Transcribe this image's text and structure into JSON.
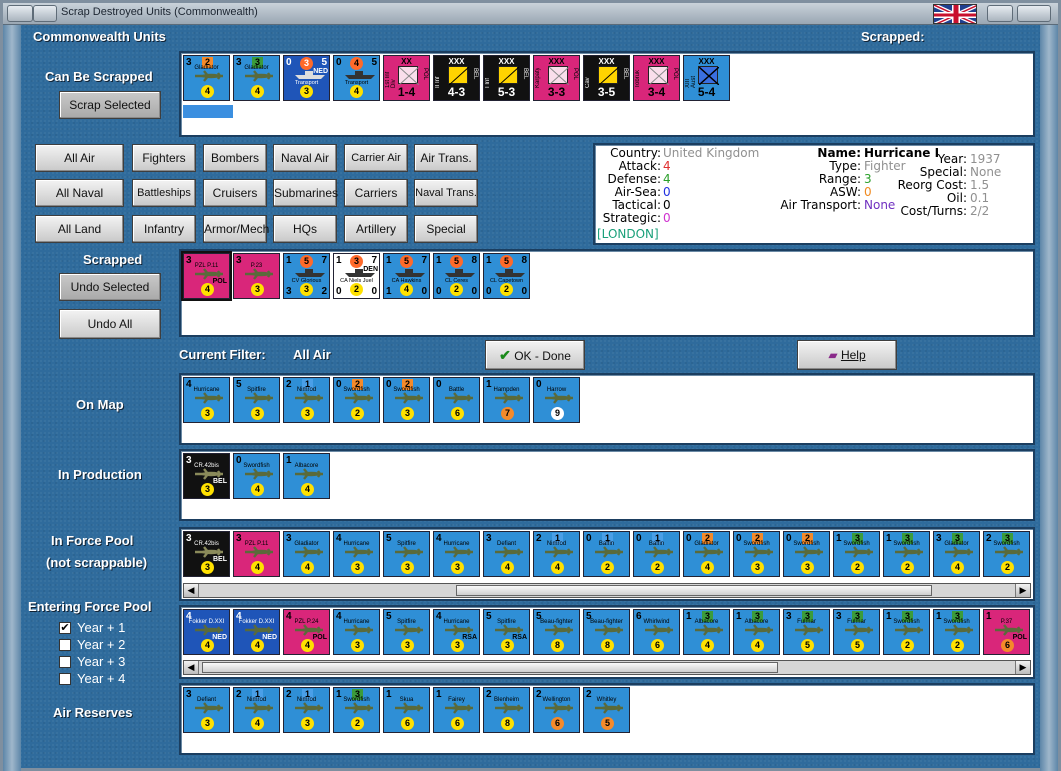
{
  "window": {
    "title": "Scrap Destroyed Units (Commonwealth)"
  },
  "header": {
    "units_label": "Commonwealth Units",
    "scrapped_label": "Scrapped:"
  },
  "can_be_scrapped": {
    "label": "Can Be Scrapped",
    "button": "Scrap Selected",
    "units": [
      {
        "name": "Gladiator",
        "lt": "3",
        "tb": "2",
        "tbc": "#f48a2a",
        "circ": "4",
        "bg": "#2f8fd6",
        "kind": "air"
      },
      {
        "name": "Gladiator",
        "lt": "3",
        "tb": "3",
        "tbc": "#3b9c3b",
        "circ": "4",
        "bg": "#2f8fd6",
        "kind": "air"
      },
      {
        "name": "Transport",
        "lt": "0",
        "tb": "3",
        "tbc": "#ff6a2a",
        "circ": "3",
        "bg": "#1f55b8",
        "kind": "naval",
        "rb": "5",
        "extra": "NED"
      },
      {
        "name": "Transport",
        "lt": "0",
        "tb": "4",
        "tbc": "#ff6a2a",
        "circ": "4",
        "bg": "#2f8fd6",
        "kind": "naval",
        "rb": "5"
      },
      {
        "name": "1st Inf Div",
        "top": "XX",
        "big": "1-4",
        "bg": "#d9267a",
        "kind": "land",
        "side": "POL"
      },
      {
        "name": "II Inf",
        "top": "XXX",
        "big": "4-3",
        "bg": "#111",
        "kind": "land",
        "side": "BEL"
      },
      {
        "name": "I Inf",
        "top": "XXX",
        "big": "5-3",
        "bg": "#111",
        "kind": "land",
        "side": "BEL"
      },
      {
        "name": "Karpaty",
        "top": "XXX",
        "big": "3-3",
        "bg": "#d9267a",
        "kind": "land",
        "side": "POL"
      },
      {
        "name": "Cav",
        "top": "XXX",
        "big": "3-5",
        "bg": "#111",
        "kind": "land",
        "side": "BEL"
      },
      {
        "name": "Tobruk",
        "top": "XXX",
        "big": "3-4",
        "bg": "#d9267a",
        "kind": "land",
        "side": "POL"
      },
      {
        "name": "XIII Aust",
        "top": "XXX",
        "big": "5-4",
        "bg": "#2f8fd6",
        "kind": "land"
      }
    ]
  },
  "filters": {
    "row1": [
      "All Air",
      "Fighters",
      "Bombers",
      "Naval Air",
      "Carrier Air",
      "Air Trans."
    ],
    "row2": [
      "All Naval",
      "Battleships",
      "Cruisers",
      "Submarines",
      "Carriers",
      "Naval Trans."
    ],
    "row3": [
      "All Land",
      "Infantry",
      "Armor/Mech",
      "HQs",
      "Artillery",
      "Special"
    ]
  },
  "info": {
    "country_k": "Country:",
    "country_v": "United Kingdom",
    "attack_k": "Attack:",
    "attack_v": "4",
    "defense_k": "Defense:",
    "defense_v": "4",
    "airsea_k": "Air-Sea:",
    "airsea_v": "0",
    "tactical_k": "Tactical:",
    "tactical_v": "0",
    "strategic_k": "Strategic:",
    "strategic_v": "0",
    "location": "[LONDON]",
    "name_k": "Name:",
    "name_v": "Hurricane I",
    "type_k": "Type:",
    "type_v": "Fighter",
    "range_k": "Range:",
    "range_v": "3",
    "asw_k": "ASW:",
    "asw_v": "0",
    "airtrans_k": "Air Transport:",
    "airtrans_v": "None",
    "year_k": "Year:",
    "year_v": "1937",
    "special_k": "Special:",
    "special_v": "None",
    "reorg_k": "Reorg Cost:",
    "reorg_v": "1.5",
    "oil_k": "Oil:",
    "oil_v": "0.1",
    "cost_k": "Cost/Turns:",
    "cost_v": "2/2",
    "colors": {
      "attack": "#e03030",
      "defense": "#2aa02a",
      "airsea": "#2030e0",
      "strategic": "#d030d0",
      "location": "#1aa07a",
      "type": "#909090",
      "range": "#2aa02a",
      "asw": "#f08a20",
      "airtrans": "#7030c0"
    }
  },
  "scrapped": {
    "label": "Scrapped",
    "undo_selected": "Undo Selected",
    "undo_all": "Undo All",
    "units": [
      {
        "name": "PZL P.11",
        "lt": "3",
        "circ": "4",
        "bg": "#d9267a",
        "kind": "air",
        "side": "POL",
        "sel": true
      },
      {
        "name": "P.23",
        "lt": "3",
        "circ": "3",
        "bg": "#d9267a",
        "kind": "air"
      },
      {
        "name": "CV Glorious",
        "lt": "1",
        "tb": "5",
        "tbc": "#ff6a2a",
        "circ": "3",
        "bg": "#2f8fd6",
        "kind": "naval",
        "rb": "7",
        "lb": "3",
        "rbb": "2"
      },
      {
        "name": "CA Niels Juel",
        "lt": "1",
        "tb": "3",
        "tbc": "#ff6a2a",
        "circ": "2",
        "bg": "#fff",
        "kind": "naval",
        "rb": "7",
        "lb": "0",
        "rbb": "0",
        "extra": "DEN"
      },
      {
        "name": "CA Hawkins",
        "lt": "1",
        "tb": "5",
        "tbc": "#ff6a2a",
        "circ": "4",
        "bg": "#2f8fd6",
        "kind": "naval",
        "rb": "7",
        "lb": "1",
        "rbb": "0"
      },
      {
        "name": "CL Ceres",
        "lt": "1",
        "tb": "5",
        "tbc": "#ff6a2a",
        "circ": "2",
        "bg": "#2f8fd6",
        "kind": "naval",
        "rb": "8",
        "lb": "0",
        "rbb": "0"
      },
      {
        "name": "CL Capetown",
        "lt": "1",
        "tb": "5",
        "tbc": "#ff6a2a",
        "circ": "2",
        "bg": "#2f8fd6",
        "kind": "naval",
        "rb": "8",
        "lb": "0",
        "rbb": "0"
      }
    ]
  },
  "filter_status": {
    "label": "Current Filter:",
    "value": "All Air"
  },
  "buttons": {
    "ok": "OK - Done",
    "help": "Help"
  },
  "on_map": {
    "label": "On Map",
    "units": [
      {
        "name": "Hurricane",
        "lt": "4",
        "circ": "3",
        "bg": "#2f8fd6",
        "kind": "air"
      },
      {
        "name": "Spitfire",
        "lt": "5",
        "circ": "3",
        "bg": "#2f8fd6",
        "kind": "air"
      },
      {
        "name": "Nimrod",
        "lt": "2",
        "tb": "1",
        "tbc": "#4a9fe8",
        "circ": "3",
        "bg": "#2f8fd6",
        "kind": "air"
      },
      {
        "name": "Swordfish",
        "lt": "0",
        "tb": "2",
        "tbc": "#f48a2a",
        "circ": "2",
        "bg": "#2f8fd6",
        "kind": "air"
      },
      {
        "name": "Swordfish",
        "lt": "0",
        "tb": "2",
        "tbc": "#f48a2a",
        "circ": "3",
        "bg": "#2f8fd6",
        "kind": "air"
      },
      {
        "name": "Battle",
        "lt": "0",
        "circ": "6",
        "bg": "#2f8fd6",
        "kind": "air"
      },
      {
        "name": "Hampden",
        "lt": "1",
        "circ": "7",
        "bg": "#2f8fd6",
        "kind": "air",
        "circc": "#f48a2a"
      },
      {
        "name": "Harrow",
        "lt": "0",
        "circ": "9",
        "bg": "#2f8fd6",
        "kind": "air",
        "circc": "#fff"
      }
    ]
  },
  "in_production": {
    "label": "In Production",
    "units": [
      {
        "name": "CR.42bis",
        "lt": "3",
        "circ": "3",
        "bg": "#111",
        "kind": "air",
        "side": "BEL"
      },
      {
        "name": "Swordfish",
        "lt": "0",
        "circ": "4",
        "bg": "#2f8fd6",
        "kind": "air"
      },
      {
        "name": "Albacore",
        "lt": "1",
        "circ": "4",
        "bg": "#2f8fd6",
        "kind": "air"
      }
    ]
  },
  "force_pool": {
    "label1": "In Force Pool",
    "label2": "(not scrappable)",
    "units": [
      {
        "name": "CR.42bis",
        "lt": "3",
        "circ": "3",
        "bg": "#111",
        "kind": "air",
        "side": "BEL"
      },
      {
        "name": "PZL P.11",
        "lt": "3",
        "circ": "4",
        "bg": "#d9267a",
        "kind": "air"
      },
      {
        "name": "Gladiator",
        "lt": "3",
        "circ": "4",
        "bg": "#2f8fd6",
        "kind": "air"
      },
      {
        "name": "Hurricane",
        "lt": "4",
        "circ": "3",
        "bg": "#2f8fd6",
        "kind": "air"
      },
      {
        "name": "Spitfire",
        "lt": "5",
        "circ": "3",
        "bg": "#2f8fd6",
        "kind": "air"
      },
      {
        "name": "Hurricane",
        "lt": "4",
        "circ": "3",
        "bg": "#2f8fd6",
        "kind": "air"
      },
      {
        "name": "Defiant",
        "lt": "3",
        "circ": "4",
        "bg": "#2f8fd6",
        "kind": "air"
      },
      {
        "name": "Nimrod",
        "lt": "2",
        "tb": "1",
        "tbc": "#4a9fe8",
        "circ": "4",
        "bg": "#2f8fd6",
        "kind": "air"
      },
      {
        "name": "Baffin",
        "lt": "0",
        "tb": "1",
        "tbc": "#4a9fe8",
        "circ": "2",
        "bg": "#2f8fd6",
        "kind": "air"
      },
      {
        "name": "Baffin",
        "lt": "0",
        "tb": "1",
        "tbc": "#4a9fe8",
        "circ": "2",
        "bg": "#2f8fd6",
        "kind": "air"
      },
      {
        "name": "Gladiator",
        "lt": "0",
        "tb": "2",
        "tbc": "#f48a2a",
        "circ": "4",
        "bg": "#2f8fd6",
        "kind": "air"
      },
      {
        "name": "Swordfish",
        "lt": "0",
        "tb": "2",
        "tbc": "#f48a2a",
        "circ": "3",
        "bg": "#2f8fd6",
        "kind": "air"
      },
      {
        "name": "Swordfish",
        "lt": "0",
        "tb": "2",
        "tbc": "#f48a2a",
        "circ": "3",
        "bg": "#2f8fd6",
        "kind": "air"
      },
      {
        "name": "Swordfish",
        "lt": "1",
        "tb": "3",
        "tbc": "#3b9c3b",
        "circ": "2",
        "bg": "#2f8fd6",
        "kind": "air"
      },
      {
        "name": "Swordfish",
        "lt": "1",
        "tb": "3",
        "tbc": "#3b9c3b",
        "circ": "2",
        "bg": "#2f8fd6",
        "kind": "air"
      },
      {
        "name": "Gladiator",
        "lt": "3",
        "tb": "3",
        "tbc": "#3b9c3b",
        "circ": "4",
        "bg": "#2f8fd6",
        "kind": "air"
      },
      {
        "name": "Swordfish",
        "lt": "2",
        "tb": "3",
        "tbc": "#3b9c3b",
        "circ": "2",
        "bg": "#2f8fd6",
        "kind": "air"
      }
    ]
  },
  "entering": {
    "label": "Entering Force Pool",
    "years": [
      {
        "label": "Year + 1",
        "checked": true
      },
      {
        "label": "Year + 2",
        "checked": false
      },
      {
        "label": "Year + 3",
        "checked": false
      },
      {
        "label": "Year + 4",
        "checked": false
      }
    ],
    "units": [
      {
        "name": "Fokker D.XXI",
        "lt": "4",
        "circ": "4",
        "bg": "#1f55b8",
        "kind": "air",
        "side": "NED"
      },
      {
        "name": "Fokker D.XXI",
        "lt": "4",
        "circ": "4",
        "bg": "#1f55b8",
        "kind": "air",
        "side": "NED"
      },
      {
        "name": "PZL P.24",
        "lt": "4",
        "circ": "4",
        "bg": "#d9267a",
        "kind": "air",
        "side": "POL"
      },
      {
        "name": "Hurricane",
        "lt": "4",
        "circ": "3",
        "bg": "#2f8fd6",
        "kind": "air"
      },
      {
        "name": "Spitfire",
        "lt": "5",
        "circ": "3",
        "bg": "#2f8fd6",
        "kind": "air"
      },
      {
        "name": "Hurricane",
        "lt": "4",
        "circ": "3",
        "bg": "#2f8fd6",
        "kind": "air",
        "side": "RSA"
      },
      {
        "name": "Spitfire",
        "lt": "5",
        "circ": "3",
        "bg": "#2f8fd6",
        "kind": "air",
        "side": "RSA"
      },
      {
        "name": "Beau-fighter",
        "lt": "5",
        "circ": "8",
        "bg": "#2f8fd6",
        "kind": "air"
      },
      {
        "name": "Beau-fighter",
        "lt": "5",
        "circ": "8",
        "bg": "#2f8fd6",
        "kind": "air"
      },
      {
        "name": "Whirlwind",
        "lt": "6",
        "circ": "6",
        "bg": "#2f8fd6",
        "kind": "air"
      },
      {
        "name": "Albacore",
        "lt": "1",
        "tb": "3",
        "tbc": "#3b9c3b",
        "circ": "4",
        "bg": "#2f8fd6",
        "kind": "air"
      },
      {
        "name": "Albacore",
        "lt": "1",
        "tb": "3",
        "tbc": "#3b9c3b",
        "circ": "4",
        "bg": "#2f8fd6",
        "kind": "air"
      },
      {
        "name": "Fulmar",
        "lt": "3",
        "tb": "3",
        "tbc": "#3b9c3b",
        "circ": "5",
        "bg": "#2f8fd6",
        "kind": "air"
      },
      {
        "name": "Fulmar",
        "lt": "3",
        "tb": "3",
        "tbc": "#3b9c3b",
        "circ": "5",
        "bg": "#2f8fd6",
        "kind": "air"
      },
      {
        "name": "Swordfish",
        "lt": "1",
        "tb": "3",
        "tbc": "#3b9c3b",
        "circ": "2",
        "bg": "#2f8fd6",
        "kind": "air"
      },
      {
        "name": "Swordfish",
        "lt": "1",
        "tb": "3",
        "tbc": "#3b9c3b",
        "circ": "2",
        "bg": "#2f8fd6",
        "kind": "air"
      },
      {
        "name": "P.37",
        "lt": "1",
        "circ": "6",
        "bg": "#d9267a",
        "kind": "air",
        "side": "POL",
        "circc": "#f48a2a"
      }
    ]
  },
  "air_reserves": {
    "label": "Air Reserves",
    "units": [
      {
        "name": "Defiant",
        "lt": "3",
        "circ": "3",
        "bg": "#2f8fd6",
        "kind": "air"
      },
      {
        "name": "Nimrod",
        "lt": "2",
        "tb": "1",
        "tbc": "#4a9fe8",
        "circ": "4",
        "bg": "#2f8fd6",
        "kind": "air"
      },
      {
        "name": "Nimrod",
        "lt": "2",
        "tb": "1",
        "tbc": "#4a9fe8",
        "circ": "3",
        "bg": "#2f8fd6",
        "kind": "air"
      },
      {
        "name": "Swordfish",
        "lt": "1",
        "tb": "3",
        "tbc": "#3b9c3b",
        "circ": "2",
        "bg": "#2f8fd6",
        "kind": "air"
      },
      {
        "name": "Skua",
        "lt": "1",
        "circ": "6",
        "bg": "#2f8fd6",
        "kind": "air"
      },
      {
        "name": "Fairey",
        "lt": "1",
        "circ": "6",
        "bg": "#2f8fd6",
        "kind": "air"
      },
      {
        "name": "Blenheim",
        "lt": "2",
        "circ": "8",
        "bg": "#2f8fd6",
        "kind": "air"
      },
      {
        "name": "Wellington",
        "lt": "2",
        "circ": "6",
        "bg": "#2f8fd6",
        "kind": "air",
        "circc": "#f48a2a"
      },
      {
        "name": "Whitley",
        "lt": "2",
        "circ": "5",
        "bg": "#2f8fd6",
        "kind": "air",
        "circc": "#f48a2a"
      }
    ]
  }
}
